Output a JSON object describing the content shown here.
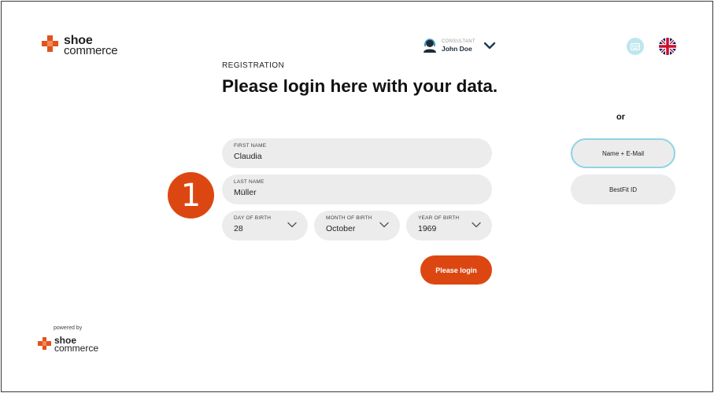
{
  "brand": {
    "line1": "shoe",
    "line2": "commerce",
    "accent": "#dc4711"
  },
  "header": {
    "consultant_label": "CONSULTANT",
    "consultant_name": "John Doe",
    "keyboard_icon": "keyboard-icon",
    "language_icon": "uk-flag-icon"
  },
  "form": {
    "section_label": "REGISTRATION",
    "heading": "Please login here with your data.",
    "first_name": {
      "label": "FIRST NAME",
      "value": "Claudia"
    },
    "last_name": {
      "label": "LAST NAME",
      "value": "Müller"
    },
    "day_of_birth": {
      "label": "DAY OF BIRTH",
      "value": "28"
    },
    "month_of_birth": {
      "label": "MONTH OF BIRTH",
      "value": "October"
    },
    "year_of_birth": {
      "label": "YEAR OF BIRTH",
      "value": "1969"
    },
    "submit_label": "Please login"
  },
  "step_badge": "1",
  "alt_login": {
    "or_label": "or",
    "options": [
      "Name + E-Mail",
      "BestFit ID"
    ],
    "active_border_color": "#8fd3e6"
  },
  "footer": {
    "powered_by": "powered by",
    "logo_line1": "shoe",
    "logo_line2": "commerce"
  }
}
